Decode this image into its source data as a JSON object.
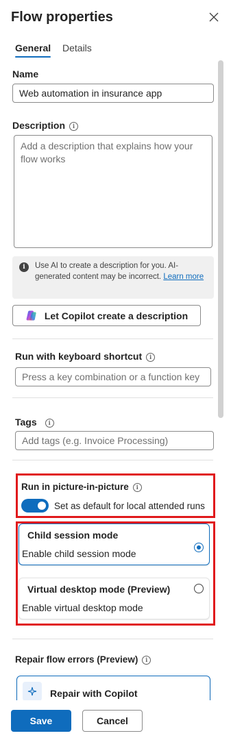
{
  "header": {
    "title": "Flow properties"
  },
  "tabs": [
    {
      "label": "General",
      "selected": true
    },
    {
      "label": "Details",
      "selected": false
    }
  ],
  "name": {
    "label": "Name",
    "value": "Web automation in insurance app"
  },
  "description": {
    "label": "Description",
    "placeholder": "Add a description that explains how your flow works",
    "ai_notice": {
      "text": "Use AI to create a description for you. AI-generated content may be incorrect. ",
      "link": "Learn more"
    },
    "copilot_button": "Let Copilot create a description"
  },
  "keyboard_shortcut": {
    "label": "Run with keyboard shortcut",
    "placeholder": "Press a key combination or a function key"
  },
  "tags": {
    "label": "Tags",
    "placeholder": "Add tags (e.g. Invoice Processing)"
  },
  "picture_in_picture": {
    "label": "Run in picture-in-picture",
    "toggle_on": true,
    "toggle_label": "Set as default for local attended runs"
  },
  "modes": [
    {
      "title": "Child session mode",
      "subtitle": "Enable child session mode",
      "selected": true
    },
    {
      "title": "Virtual desktop mode (Preview)",
      "subtitle": "Enable virtual desktop mode",
      "selected": false
    }
  ],
  "repair": {
    "label": "Repair flow errors (Preview)",
    "toggle_on": true,
    "card_title": "Repair with Copilot",
    "card_selected": true
  },
  "footer": {
    "save": "Save",
    "cancel": "Cancel"
  },
  "colors": {
    "accent": "#0f6cbd",
    "highlight": "#e0191b"
  }
}
